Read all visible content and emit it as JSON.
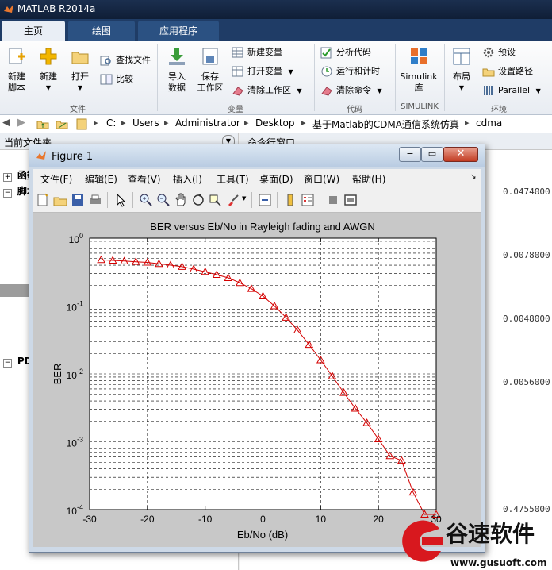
{
  "app": {
    "title": "MATLAB R2014a",
    "tabs": [
      {
        "label": "主页"
      },
      {
        "label": "绘图"
      },
      {
        "label": "应用程序"
      }
    ]
  },
  "ribbon": {
    "file": {
      "new_script": "新建\n脚本",
      "new": "新建",
      "open": "打开",
      "find_files": "查找文件",
      "compare": "比较",
      "group": "文件"
    },
    "variable": {
      "import": "导入\n数据",
      "save_ws": "保存\n工作区",
      "new_var": "新建变量",
      "open_var": "打开变量",
      "clear_ws": "清除工作区",
      "group": "变量"
    },
    "code": {
      "analyze": "分析代码",
      "run_time": "运行和计时",
      "clear_cmd": "清除命令",
      "group": "代码"
    },
    "simulink": {
      "lib": "Simulink\n库",
      "group": "SIMULINK"
    },
    "env": {
      "layout": "布局",
      "prefs": "预设",
      "set_path": "设置路径",
      "parallel": "Parallel",
      "group": "环境"
    }
  },
  "address": {
    "path": [
      "C:",
      "Users",
      "Administrator",
      "Desktop",
      "基于Matlab的CDMA通信系统仿真",
      "cdma"
    ]
  },
  "left_pane": {
    "header": "当前文件夹",
    "items": [
      {
        "label": "函数"
      },
      {
        "label": "脚本"
      },
      {
        "label": "PDF"
      }
    ]
  },
  "command_window": {
    "header": "命令行窗口",
    "values": [
      "0.0474000",
      "0.0078000",
      "0.0048000",
      "0.0056000",
      "0.4755000"
    ]
  },
  "figure": {
    "title": "Figure 1",
    "menus": [
      "文件(F)",
      "编辑(E)",
      "查看(V)",
      "插入(I)",
      "工具(T)",
      "桌面(D)",
      "窗口(W)",
      "帮助(H)"
    ]
  },
  "chart_data": {
    "type": "line",
    "title": "BER versus Eb/No in Rayleigh fading and AWGN",
    "xlabel": "Eb/No (dB)",
    "ylabel": "BER",
    "xlim": [
      -30,
      30
    ],
    "ylim": [
      0.0001,
      1
    ],
    "yscale": "log",
    "x_ticks": [
      "-30",
      "-20",
      "-10",
      "0",
      "10",
      "20",
      "30"
    ],
    "y_ticks": [
      {
        "base": "10",
        "exp": "0"
      },
      {
        "base": "10",
        "exp": "-1"
      },
      {
        "base": "10",
        "exp": "-2"
      },
      {
        "base": "10",
        "exp": "-3"
      },
      {
        "base": "10",
        "exp": "-4"
      }
    ],
    "grid": true,
    "series": [
      {
        "color": "#d40000",
        "marker": "triangle",
        "x": [
          -28,
          -26,
          -24,
          -22,
          -20,
          -18,
          -16,
          -14,
          -12,
          -10,
          -8,
          -6,
          -4,
          -2,
          0,
          2,
          4,
          6,
          8,
          10,
          12,
          14,
          16,
          18,
          20,
          22,
          24,
          26,
          28,
          30
        ],
        "y": [
          0.48,
          0.47,
          0.46,
          0.45,
          0.44,
          0.42,
          0.4,
          0.38,
          0.35,
          0.32,
          0.29,
          0.26,
          0.22,
          0.18,
          0.14,
          0.1,
          0.068,
          0.044,
          0.027,
          0.016,
          0.0093,
          0.0053,
          0.0031,
          0.0019,
          0.0011,
          0.00062,
          0.00053,
          0.00018,
          8.5e-05,
          8.5e-05
        ]
      }
    ]
  }
}
